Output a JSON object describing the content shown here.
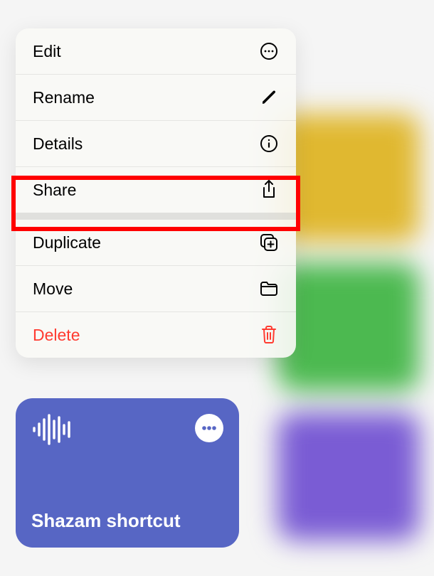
{
  "menu": {
    "edit": "Edit",
    "rename": "Rename",
    "details": "Details",
    "share": "Share",
    "duplicate": "Duplicate",
    "move": "Move",
    "delete": "Delete"
  },
  "card": {
    "title": "Shazam shortcut"
  }
}
